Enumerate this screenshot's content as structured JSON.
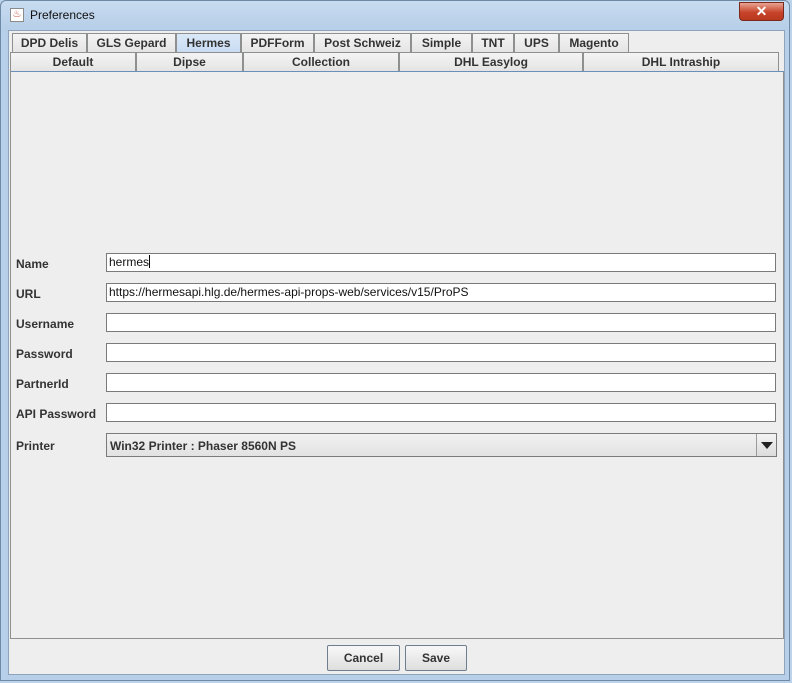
{
  "window": {
    "title": "Preferences",
    "close_label": "✕"
  },
  "tabs": {
    "row1": [
      "DPD Delis",
      "GLS Gepard",
      "Hermes",
      "PDFForm",
      "Post Schweiz",
      "Simple",
      "TNT",
      "UPS",
      "Magento"
    ],
    "row2": [
      "Default",
      "Dipse",
      "Collection",
      "DHL Easylog",
      "DHL Intraship"
    ],
    "selected": "Hermes"
  },
  "form": {
    "name_label": "Name",
    "name_value": "hermes",
    "url_label": "URL",
    "url_value": "https://hermesapi.hlg.de/hermes-api-props-web/services/v15/ProPS",
    "username_label": "Username",
    "username_value": "",
    "password_label": "Password",
    "password_value": "",
    "partnerid_label": "PartnerId",
    "partnerid_value": "",
    "apipassword_label": "API Password",
    "apipassword_value": "",
    "printer_label": "Printer",
    "printer_value": "Win32 Printer : Phaser 8560N PS"
  },
  "buttons": {
    "cancel": "Cancel",
    "save": "Save"
  },
  "icons": {
    "app": "java-cup-icon",
    "close": "close-icon",
    "dropdown": "chevron-down-icon"
  }
}
